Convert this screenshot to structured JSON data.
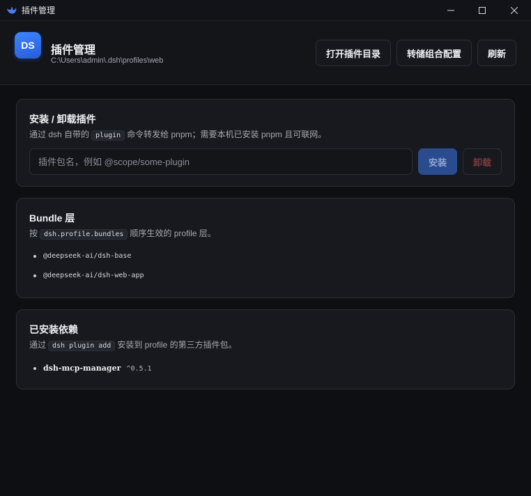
{
  "window": {
    "title": "插件管理"
  },
  "header": {
    "avatar": "DS",
    "title": "插件管理",
    "path": "C:\\Users\\admin\\.dsh\\profiles\\web",
    "buttons": {
      "open_dir": "打开插件目录",
      "convert": "转储组合配置",
      "refresh": "刷新"
    }
  },
  "install_card": {
    "title": "安装 / 卸载插件",
    "desc_prefix": "通过 dsh 自带的",
    "desc_code": "plugin",
    "desc_suffix": "命令转发给 pnpm；需要本机已安装 pnpm 且可联网。",
    "input_placeholder": "插件包名，例如 @scope/some-plugin",
    "install_label": "安装",
    "uninstall_label": "卸载"
  },
  "bundle_card": {
    "title": "Bundle 层",
    "desc_prefix": "按",
    "desc_code": "dsh.profile.bundles",
    "desc_suffix": "顺序生效的 profile 层。",
    "items": [
      "@deepseek-ai/dsh-base",
      "@deepseek-ai/dsh-web-app"
    ]
  },
  "deps_card": {
    "title": "已安装依赖",
    "desc_prefix": "通过",
    "desc_code": "dsh plugin add",
    "desc_suffix": "安装到 profile 的第三方插件包。",
    "items": [
      {
        "name": "dsh-mcp-manager",
        "version": "^0.5.1"
      }
    ]
  },
  "colors": {
    "accent": "#2a5bd6",
    "background": "#0e0f12",
    "card": "#17191e",
    "danger": "#7b3a3d"
  }
}
